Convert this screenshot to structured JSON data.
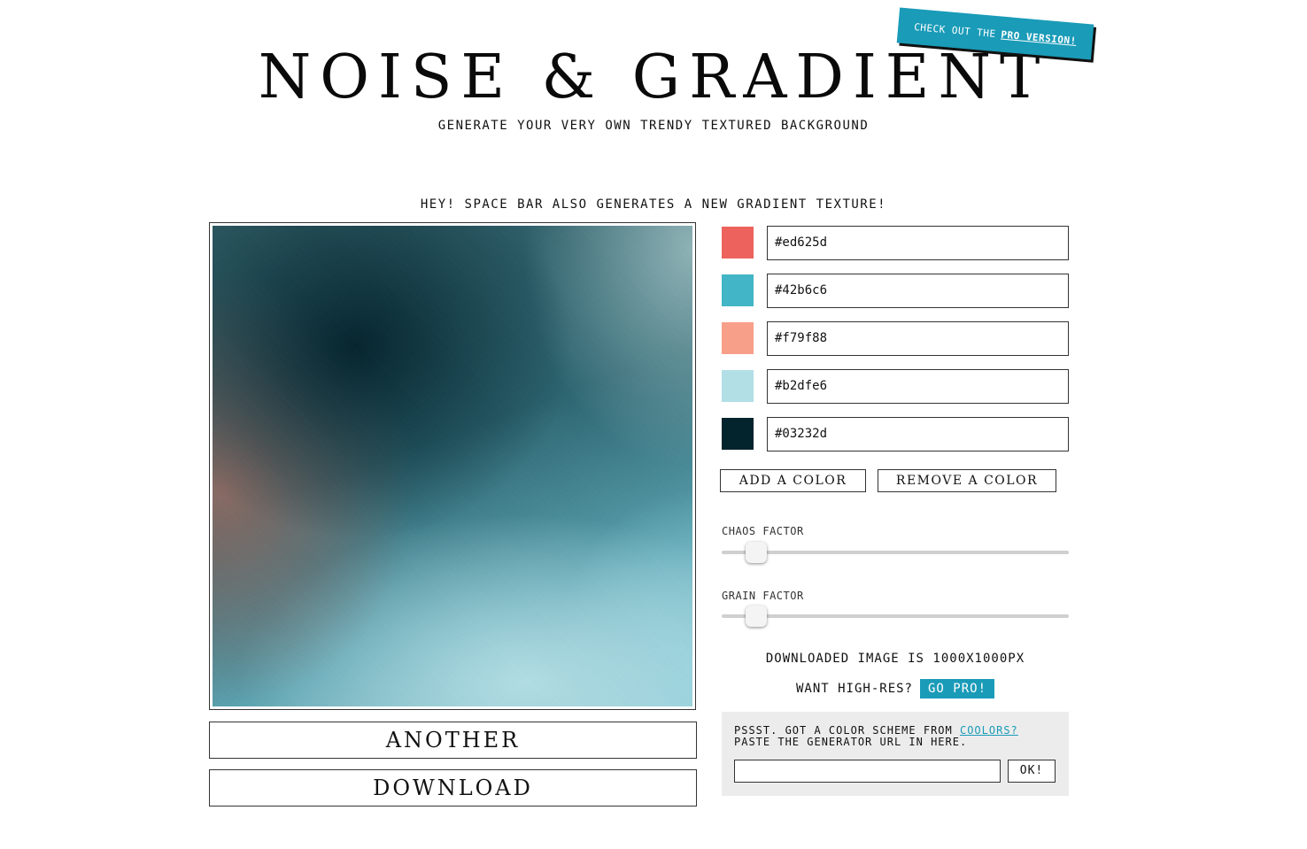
{
  "header": {
    "title": "NOISE & GRADIENT",
    "subtitle": "GENERATE YOUR VERY OWN TRENDY TEXTURED BACKGROUND",
    "pro_banner_text": "CHECK OUT THE",
    "pro_banner_link": "PRO VERSION!"
  },
  "hint": "HEY! SPACE BAR ALSO GENERATES A NEW GRADIENT TEXTURE!",
  "buttons": {
    "another": "ANOTHER",
    "download": "DOWNLOAD",
    "add_color": "ADD A COLOR",
    "remove_color": "REMOVE A COLOR"
  },
  "colors": [
    {
      "hex": "#ed625d"
    },
    {
      "hex": "#42b6c6"
    },
    {
      "hex": "#f79f88"
    },
    {
      "hex": "#b2dfe6"
    },
    {
      "hex": "#03232d"
    }
  ],
  "sliders": {
    "chaos": {
      "label": "CHAOS FACTOR",
      "value": 0.1
    },
    "grain": {
      "label": "GRAIN FACTOR",
      "value": 0.1
    }
  },
  "info": {
    "downloaded": "DOWNLOADED IMAGE IS 1000X1000PX",
    "want_high_res": "WANT HIGH-RES?",
    "go_pro": "GO PRO!"
  },
  "coolors": {
    "line1_prefix": "PSSST. GOT A COLOR SCHEME FROM",
    "link": "COOLORS?",
    "line2": "PASTE THE GENERATOR URL IN HERE.",
    "url_value": "",
    "ok": "OK!"
  },
  "accent_color": "#1a9bb8"
}
